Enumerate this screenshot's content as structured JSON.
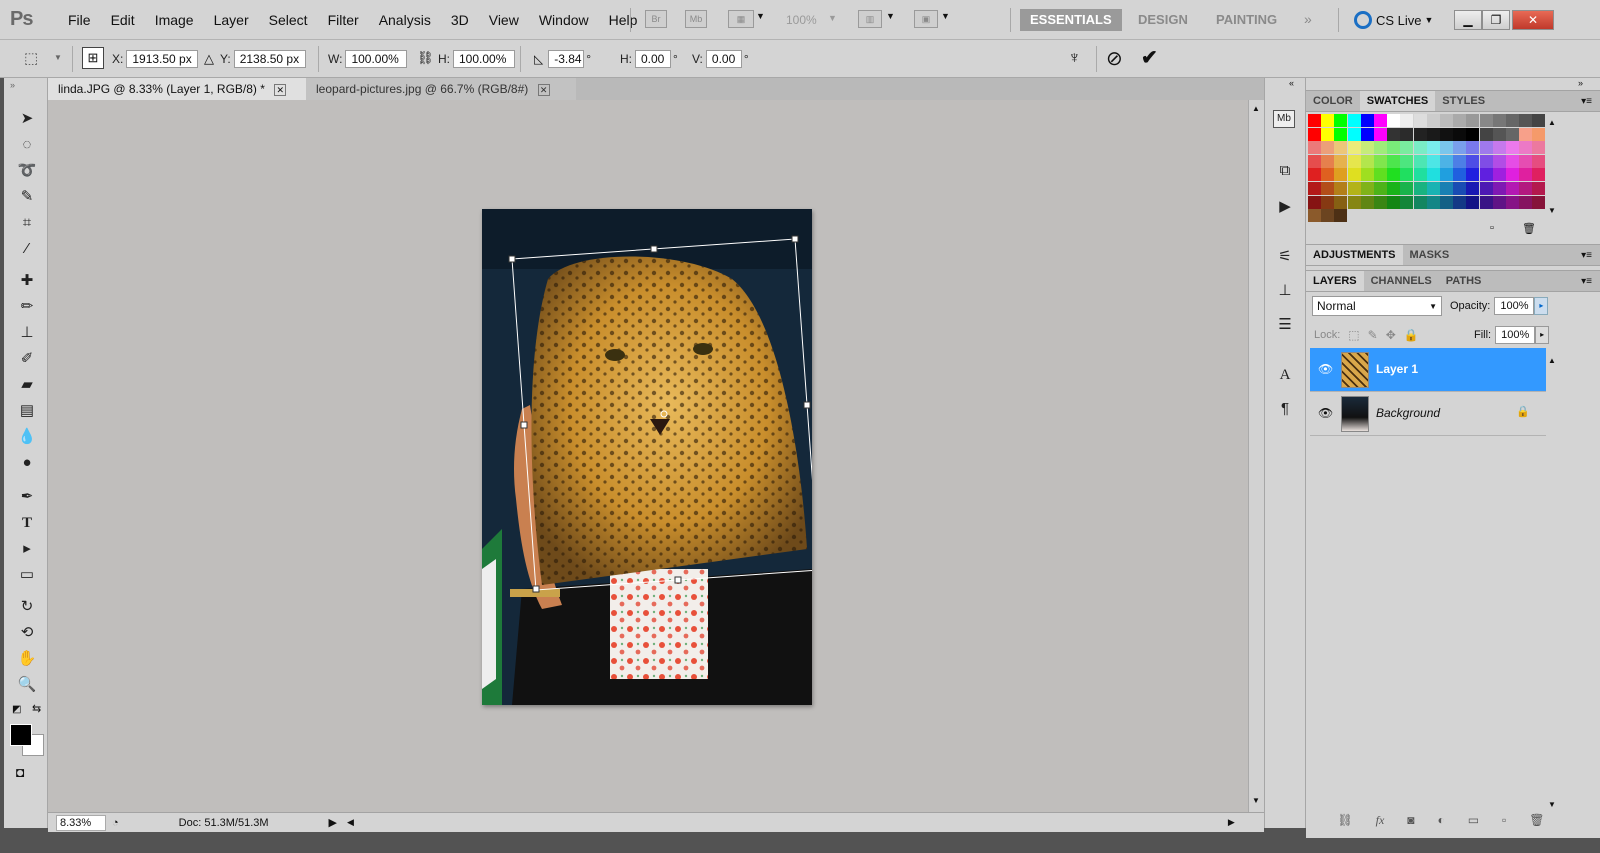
{
  "app": {
    "logo": "Ps"
  },
  "menu": [
    "File",
    "Edit",
    "Image",
    "Layer",
    "Select",
    "Filter",
    "Analysis",
    "3D",
    "View",
    "Window",
    "Help"
  ],
  "menubar": {
    "bridge_label": "Br",
    "minibridge_label": "Mb",
    "zoom_level": "100%",
    "workspaces": [
      "ESSENTIALS",
      "DESIGN",
      "PAINTING"
    ],
    "cs_live": "CS Live"
  },
  "options": {
    "x_label": "X:",
    "x_value": "1913.50 px",
    "y_label": "Y:",
    "y_value": "2138.50 px",
    "w_label": "W:",
    "w_value": "100.00%",
    "h_label": "H:",
    "h_value": "100.00%",
    "angle_value": "-3.84",
    "hskew_label": "H:",
    "hskew_value": "0.00",
    "vskew_label": "V:",
    "vskew_value": "0.00",
    "degree": "°"
  },
  "tabs": [
    {
      "label": "linda.JPG @ 8.33% (Layer 1, RGB/8) *"
    },
    {
      "label": "leopard-pictures.jpg @ 66.7% (RGB/8#)"
    }
  ],
  "status": {
    "zoom": "8.33%",
    "doc": "Doc: 51.3M/51.3M"
  },
  "panels": {
    "swatch_tabs": [
      "COLOR",
      "SWATCHES",
      "STYLES"
    ],
    "adjust_tabs": [
      "ADJUSTMENTS",
      "MASKS"
    ],
    "layer_tabs": [
      "LAYERS",
      "CHANNELS",
      "PATHS"
    ],
    "blend_mode": "Normal",
    "opacity_label": "Opacity:",
    "opacity_value": "100%",
    "lock_label": "Lock:",
    "fill_label": "Fill:",
    "fill_value": "100%",
    "layers": [
      {
        "name": "Layer 1",
        "selected": true
      },
      {
        "name": "Background",
        "selected": false
      }
    ]
  },
  "colors": {
    "chrome": "#d4d4d4",
    "canvas_bg": "#c0bebc",
    "selection": "#3399ff",
    "swatch_row1": [
      "#ff0000",
      "#ffff00",
      "#00ff00",
      "#00ffff",
      "#0000ff",
      "#ff00ff",
      "#ffffff",
      "#eeeeee",
      "#dddddd",
      "#cccccc",
      "#bbbbbb",
      "#aaaaaa",
      "#999999",
      "#888888",
      "#777777",
      "#666666",
      "#555555",
      "#444444"
    ],
    "swatch_row2": [
      "#ff0000",
      "#ffff00",
      "#00ff00",
      "#00ffff",
      "#0000ff",
      "#ff00ff",
      "#333333",
      "#2b2b2b",
      "#222222",
      "#1a1a1a",
      "#111111",
      "#0a0a0a",
      "#000000",
      "#444444",
      "#555555",
      "#666666",
      "#f7a08a",
      "#f59a6a"
    ]
  }
}
